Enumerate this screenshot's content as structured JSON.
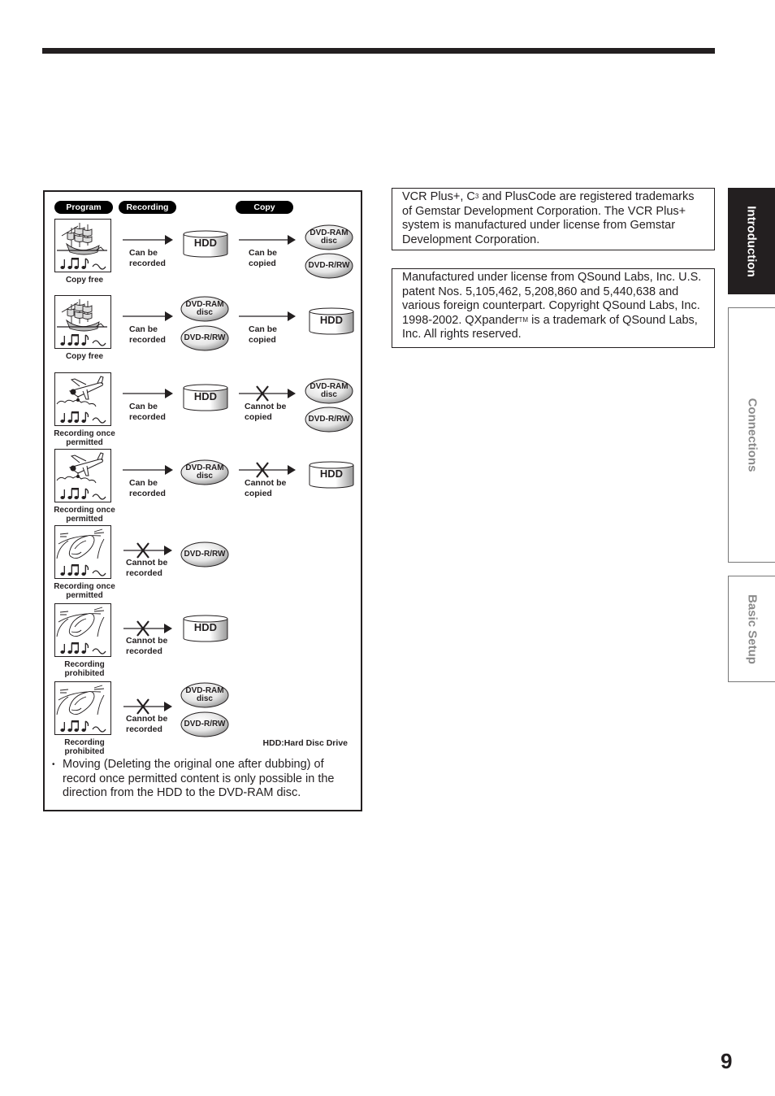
{
  "header": {
    "page_number": "9"
  },
  "side_tabs": [
    {
      "label": "Introduction",
      "active": true
    },
    {
      "label": "Connections",
      "active": false
    },
    {
      "label": "Basic Setup",
      "active": false
    }
  ],
  "diagram": {
    "column_headers": {
      "program": "Program",
      "recording": "Recording",
      "copy": "Copy"
    },
    "rows": [
      {
        "picture": "ship-icon",
        "caption": "Copy free",
        "record_label": "Can be recorded",
        "record_allowed": true,
        "record_media": [
          "HDD"
        ],
        "copy_label": "Can be copied",
        "copy_allowed": true,
        "copy_media": [
          "DVD-RAM disc",
          "DVD-R/RW"
        ]
      },
      {
        "picture": "ship-icon",
        "caption": "Copy free",
        "record_label": "Can be recorded",
        "record_allowed": true,
        "record_media": [
          "DVD-RAM disc",
          "DVD-R/RW"
        ],
        "copy_label": "Can be copied",
        "copy_allowed": true,
        "copy_media": [
          "HDD"
        ]
      },
      {
        "picture": "airplane-icon",
        "caption": "Recording once permitted",
        "record_label": "Can be recorded",
        "record_allowed": true,
        "record_media": [
          "HDD"
        ],
        "copy_label": "Cannot be copied",
        "copy_allowed": false,
        "copy_media": [
          "DVD-RAM disc",
          "DVD-R/RW"
        ]
      },
      {
        "picture": "airplane-icon",
        "caption": "Recording once permitted",
        "record_label": "Can be recorded",
        "record_allowed": true,
        "record_media": [
          "DVD-RAM disc"
        ],
        "copy_label": "Cannot be copied",
        "copy_allowed": false,
        "copy_media": [
          "HDD"
        ]
      },
      {
        "picture": "car-icon",
        "caption": "Recording once permitted",
        "record_label": "Cannot be recorded",
        "record_allowed": false,
        "record_media": [
          "DVD-R/RW"
        ]
      },
      {
        "picture": "car-icon",
        "caption": "Recording prohibited",
        "record_label": "Cannot be recorded",
        "record_allowed": false,
        "record_media": [
          "HDD"
        ]
      },
      {
        "picture": "car-icon",
        "caption": "Recording prohibited",
        "record_label": "Cannot be recorded",
        "record_allowed": false,
        "record_media": [
          "DVD-RAM disc",
          "DVD-R/RW"
        ]
      }
    ],
    "legend": "HDD:Hard Disc Drive",
    "note": "Moving (Deleting the original one after dubbing) of record once permitted content is only possible in the direction from the HDD to the DVD-RAM disc."
  },
  "notices": {
    "vcr_plus": {
      "part1": "VCR Plus+, C",
      "sup": "3",
      "part2": " and PlusCode are registered trademarks of Gemstar Development Corporation. The VCR Plus+ system is manufactured under license from Gemstar Development Corporation."
    },
    "qsound": {
      "part1": "Manufactured under license from QSound Labs, Inc. U.S. patent Nos. 5,105,462, 5,208,860 and 5,440,638 and various foreign counterpart. Copyright QSound Labs, Inc. 1998-2002. QXpander",
      "sup": "TM",
      "part2": " is a trademark of QSound Labs, Inc. All rights reserved."
    }
  }
}
